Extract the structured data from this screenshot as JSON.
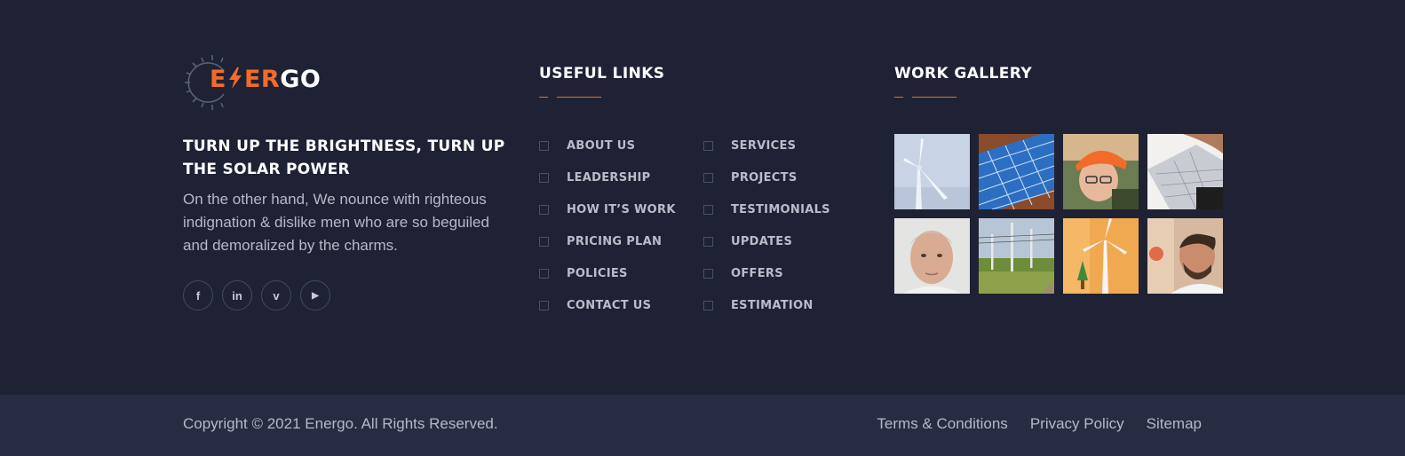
{
  "brand": {
    "logo_part1": "E",
    "logo_part2": "ER",
    "logo_part3": "GO",
    "accent_color": "#f26b2a"
  },
  "about": {
    "tagline": "TURN UP THE BRIGHTNESS, TURN UP THE SOLAR POWER",
    "text": "On the other hand, We nounce with righteous indignation & dislike men who are so beguiled and demoralized by the charms."
  },
  "socials": [
    {
      "icon": "facebook-icon",
      "glyph": "f"
    },
    {
      "icon": "linkedin-icon",
      "glyph": "in"
    },
    {
      "icon": "vimeo-icon",
      "glyph": "v"
    },
    {
      "icon": "youtube-icon",
      "glyph": "▶"
    }
  ],
  "useful_links": {
    "title": "USEFUL LINKS",
    "col1": [
      "ABOUT US",
      "LEADERSHIP",
      "HOW IT’S WORK",
      "PRICING PLAN",
      "POLICIES",
      "CONTACT US"
    ],
    "col2": [
      "SERVICES",
      "PROJECTS",
      "TESTIMONIALS",
      "UPDATES",
      "OFFERS",
      "ESTIMATION"
    ]
  },
  "gallery": {
    "title": "WORK GALLERY",
    "images": [
      "wind-turbine",
      "solar-panel",
      "engineer-hard-hat",
      "solar-panel-closeup",
      "man-portrait",
      "power-lines-field",
      "turbine-model",
      "smiling-man"
    ]
  },
  "bottom": {
    "copyright": "Copyright © 2021 Energo. All Rights Reserved.",
    "links": [
      "Terms & Conditions",
      "Privacy Policy",
      "Sitemap"
    ]
  }
}
